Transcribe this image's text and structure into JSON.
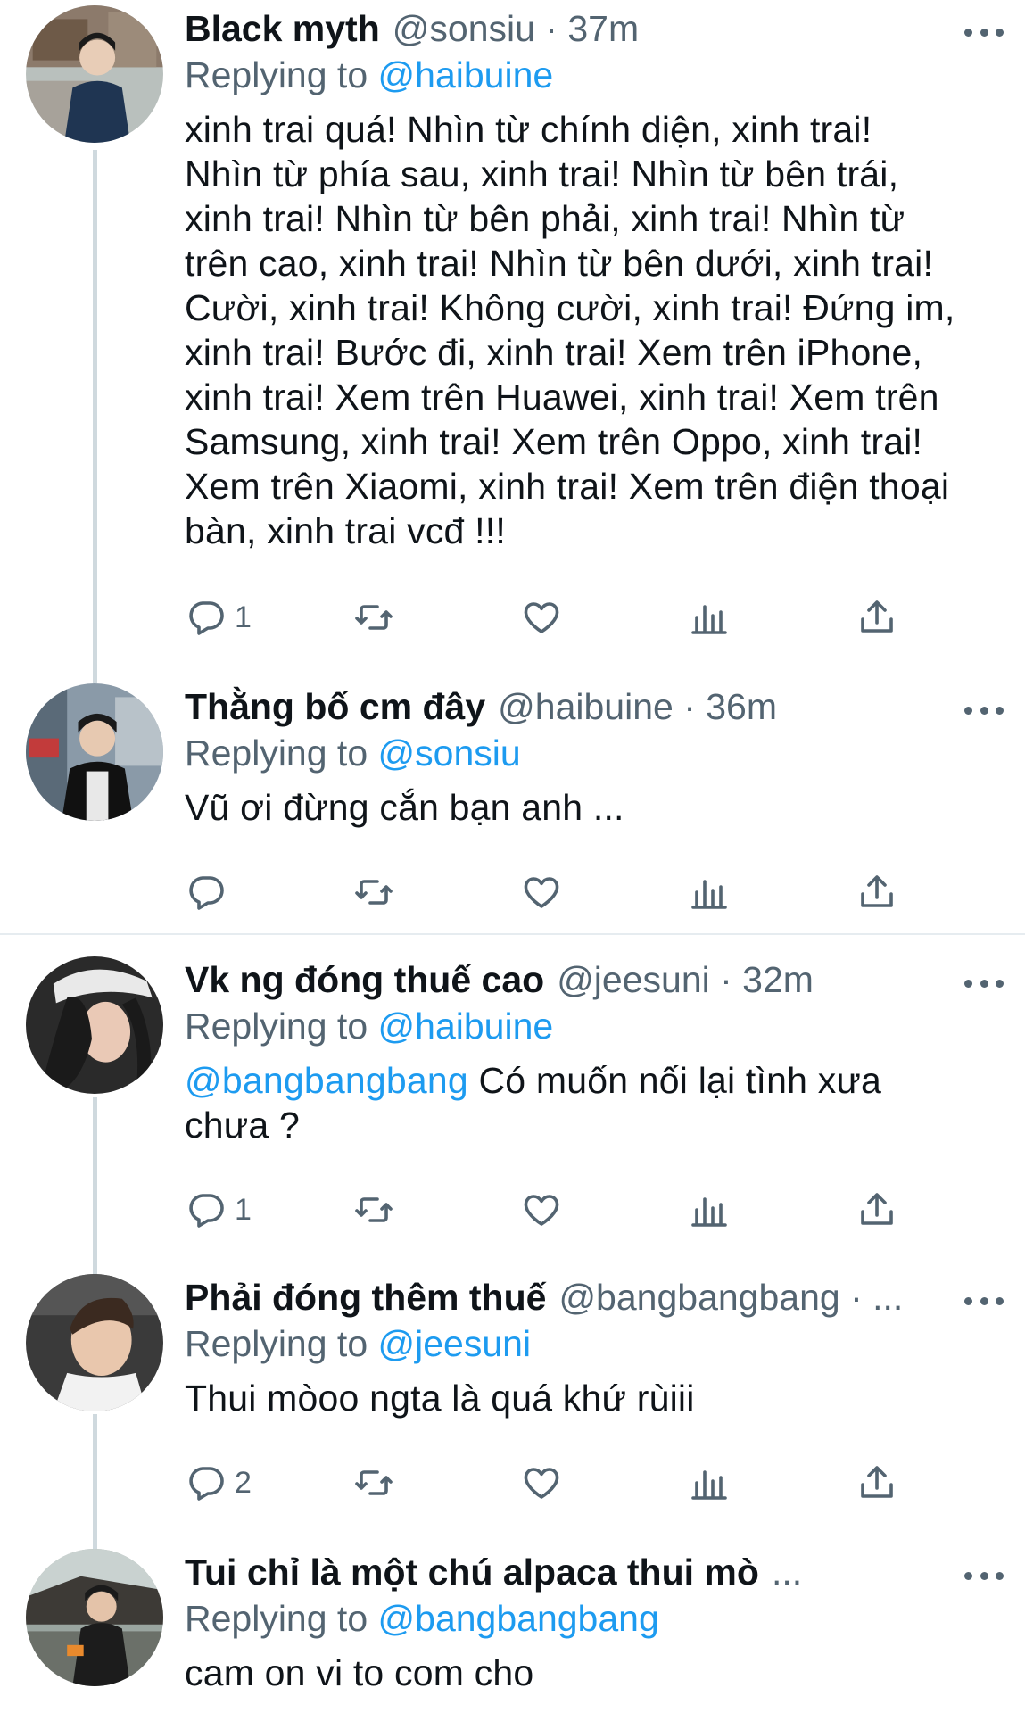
{
  "tweets": [
    {
      "display_name": "Black myth",
      "handle_meta": "@sonsiu · 37m",
      "replying_prefix": "Replying to ",
      "replying_to": "@haibuine",
      "body_mention": "",
      "body": "xinh trai quá! Nhìn từ chính diện, xinh trai!\nNhìn từ phía sau, xinh trai! Nhìn từ bên trái,\nxinh trai! Nhìn từ bên phải, xinh trai! Nhìn từ\ntrên cao, xinh trai! Nhìn từ bên dưới, xinh trai!\nCười, xinh trai! Không cười, xinh trai! Đứng im,\nxinh trai! Bước đi, xinh trai! Xem trên iPhone,\nxinh trai! Xem trên Huawei, xinh trai! Xem trên\nSamsung, xinh trai! Xem trên Oppo, xinh trai!\nXem trên Xiaomi, xinh trai! Xem trên điện thoại\nbàn, xinh trai vcđ !!!",
      "reply_count": "1",
      "avatar_icon": "avatar-photo"
    },
    {
      "display_name": "Thằng bố cm đây",
      "handle_meta": "@haibuine · 36m",
      "replying_prefix": "Replying to ",
      "replying_to": "@sonsiu",
      "body_mention": "",
      "body": "Vũ ơi đừng cắn bạn anh ...",
      "reply_count": "",
      "avatar_icon": "avatar-photo"
    },
    {
      "display_name": "Vk ng đóng thuế cao",
      "handle_meta": "@jeesuni · 32m",
      "replying_prefix": "Replying to ",
      "replying_to": "@haibuine",
      "body_mention": "@bangbangbang",
      "body": " Có muốn nối lại tình xưa\nchưa ?",
      "reply_count": "1",
      "avatar_icon": "avatar-photo"
    },
    {
      "display_name": "Phải đóng thêm thuế",
      "handle_meta": "@bangbangbang · ...",
      "replying_prefix": "Replying to ",
      "replying_to": "@jeesuni",
      "body_mention": "",
      "body": "Thui mòoo ngta là quá khứ rùiii",
      "reply_count": "2",
      "avatar_icon": "avatar-photo"
    },
    {
      "display_name": "Tui chỉ là một chú alpaca thui mò",
      "handle_meta": "...",
      "replying_prefix": "Replying to ",
      "replying_to": "@bangbangbang",
      "body_mention": "",
      "body": "cam on vi to com cho",
      "reply_count": "",
      "avatar_icon": "avatar-photo"
    }
  ],
  "icons": {
    "reply": "reply-icon",
    "retweet": "retweet-icon",
    "like": "like-icon",
    "analytics": "analytics-icon",
    "share": "share-icon",
    "more": "more-icon"
  },
  "colors": {
    "text": "#0f1419",
    "secondary": "#536471",
    "link": "#1d9bf0",
    "thread_line": "#cfd9de",
    "divider": "#e6ecf0"
  }
}
